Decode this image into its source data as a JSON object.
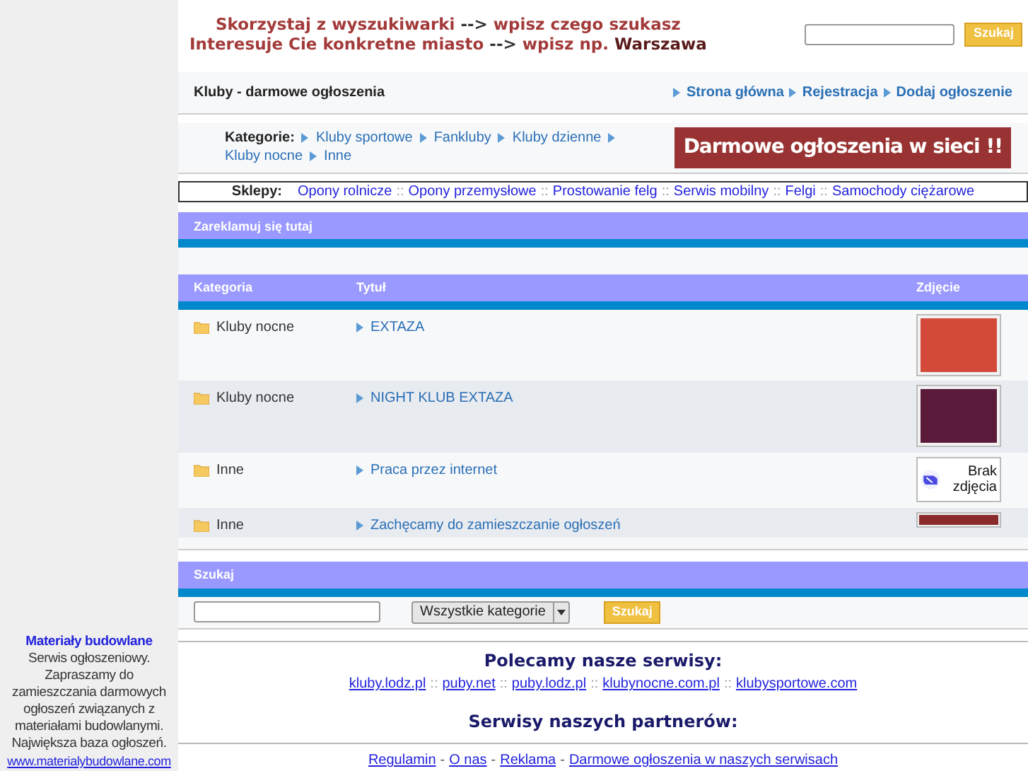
{
  "header": {
    "promo_lines": [
      [
        {
          "text": "Skorzystaj z wyszukiwarki",
          "kind": "accent"
        },
        {
          "text": "-->",
          "kind": "plain"
        },
        {
          "text": "wpisz czego szukasz",
          "kind": "accent"
        }
      ],
      [
        {
          "text": "Interesuje Cie konkretne miasto",
          "kind": "accent"
        },
        {
          "text": "-->",
          "kind": "plain"
        },
        {
          "text": "wpisz np.",
          "kind": "accent"
        },
        {
          "text": "Warszawa",
          "kind": "strong"
        }
      ]
    ],
    "search": {
      "button": "Szukaj"
    }
  },
  "title_bar": {
    "title": "Kluby - darmowe ogłoszenia",
    "links": [
      "Strona główna",
      "Rejestracja",
      "Dodaj ogłoszenie"
    ]
  },
  "categories": {
    "label": "Kategorie:",
    "items": [
      "Kluby sportowe",
      "Fankluby",
      "Kluby dzienne",
      "Kluby nocne",
      "Inne"
    ],
    "banner": "Darmowe ogłoszenia w sieci !!"
  },
  "shops": {
    "label": "Sklepy:",
    "separator": "::",
    "items": [
      "Opony rolnicze",
      "Opony przemysłowe",
      "Prostowanie felg",
      "Serwis mobilny",
      "Felgi",
      "Samochody ciężarowe"
    ]
  },
  "ad_section": {
    "title": "Zareklamuj się tutaj"
  },
  "table": {
    "columns": [
      "Kategoria",
      "Tytuł",
      "Zdjęcie"
    ],
    "rows": [
      {
        "category": "Kluby nocne",
        "title": "EXTAZA",
        "picture": {
          "kind": "photo"
        }
      },
      {
        "category": "Kluby nocne",
        "title": "NIGHT KLUB EXTAZA",
        "picture": {
          "kind": "photo"
        }
      },
      {
        "category": "Inne",
        "title": "Praca przez internet",
        "picture": {
          "kind": "no-photo",
          "text": "Brak zdjęcia"
        }
      },
      {
        "category": "Inne",
        "title": "Zachęcamy do zamieszczanie ogłoszeń",
        "picture": {
          "kind": "banner"
        }
      }
    ]
  },
  "search_section": {
    "title": "Szukaj",
    "select": "Wszystkie kategorie",
    "button": "Szukaj"
  },
  "footer": {
    "recommended_title": "Polecamy nasze serwisy:",
    "link_separator": "::",
    "bottom_separator": "-",
    "recommended_links": [
      "kluby.lodz.pl",
      "puby.net",
      "puby.lodz.pl",
      "klubynocne.com.pl",
      "klubysportowe.com"
    ],
    "partners_title": "Serwisy naszych partnerów:",
    "bottom_links": [
      "Regulamin",
      "O nas",
      "Reklama",
      "Darmowe ogłoszenia w naszych serwisach"
    ]
  },
  "sidebar": {
    "title": "Materiały budowlane",
    "text": "Serwis ogłoszeniowy. Zapraszamy do zamieszczania darmowych ogłoszeń związanych z materiałami budowlanymi. Największa baza ogłoszeń.",
    "link": "www.materialybudowlane.com"
  }
}
